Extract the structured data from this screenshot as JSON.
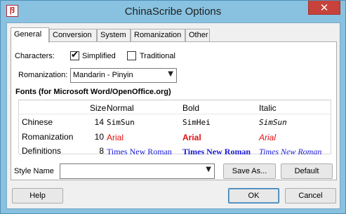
{
  "window": {
    "title": "ChinaScribe Options",
    "icon_glyph": "卪",
    "close_glyph": "✕"
  },
  "tabs": [
    {
      "label": "General",
      "active": true
    },
    {
      "label": "Conversion",
      "active": false
    },
    {
      "label": "System",
      "active": false
    },
    {
      "label": "Romanization",
      "active": false
    },
    {
      "label": "Other",
      "active": false
    }
  ],
  "general": {
    "characters_label": "Characters:",
    "simplified": {
      "label": "Simplified",
      "checked": true
    },
    "traditional": {
      "label": "Traditional",
      "checked": false
    },
    "romanization_label": "Romanization:",
    "romanization_value": "Mandarin - Pinyin",
    "fonts_title": "Fonts (for Microsoft Word/OpenOffice.org)",
    "fonts_table": {
      "headers": {
        "size": "Size",
        "normal": "Normal",
        "bold": "Bold",
        "italic": "Italic"
      },
      "rows": [
        {
          "label": "Chinese",
          "size": "14",
          "normal": "SimSun",
          "bold": "SimHei",
          "italic": "SimSun"
        },
        {
          "label": "Romanization",
          "size": "10",
          "normal": "Arial",
          "bold": "Arial",
          "italic": "Arial"
        },
        {
          "label": "Definitions",
          "size": "8",
          "normal": "Times New Roman",
          "bold": "Times New Roman",
          "italic": "Times New Roman"
        }
      ]
    }
  },
  "style": {
    "label": "Style Name",
    "value": "",
    "save_as_label": "Save As...",
    "default_label": "Default"
  },
  "footer": {
    "help_label": "Help",
    "ok_label": "OK",
    "cancel_label": "Cancel"
  },
  "icons": {
    "check_mark": "✔",
    "dropdown_arrow": "▼"
  },
  "colors": {
    "frame": "#88c2e0",
    "close_button": "#c7423b",
    "arial_sample": "#e01010",
    "tnr_sample": "#1a1ad6"
  }
}
